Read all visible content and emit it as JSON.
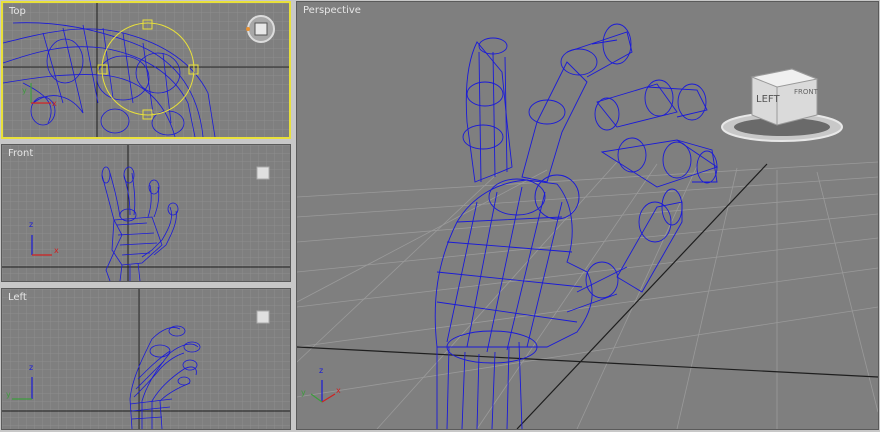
{
  "viewports": {
    "top": {
      "label": "Top",
      "active": true
    },
    "front": {
      "label": "Front"
    },
    "left": {
      "label": "Left"
    },
    "perspective": {
      "label": "Perspective"
    }
  },
  "viewcube": {
    "left_face": "LEFT",
    "front_face": "FRONT"
  },
  "axes": {
    "x": "x",
    "y": "y",
    "z": "z"
  },
  "colors": {
    "viewport_bg": "#7f7f7f",
    "grid": "#8e8e8e",
    "wireframe": "#1a1ad8",
    "active_border": "#e8e03a",
    "gizmo": "#e8e03a"
  }
}
